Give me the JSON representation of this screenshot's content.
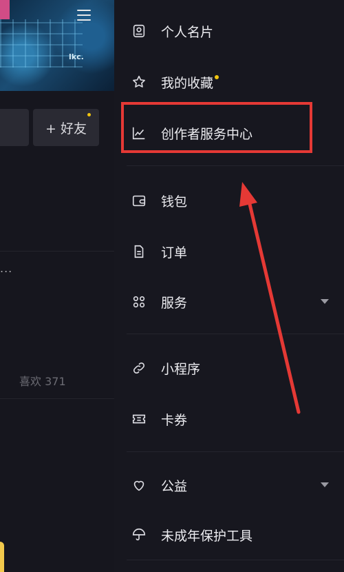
{
  "left_panel": {
    "cover_tag": "lkc.",
    "add_friend_label": "+ 好友",
    "more_label": "...",
    "likes_label": "喜欢 371"
  },
  "drawer": {
    "items": [
      {
        "label": "个人名片",
        "icon": "id-card-icon"
      },
      {
        "label": "我的收藏",
        "icon": "star-icon",
        "has_dot": true
      },
      {
        "label": "创作者服务中心",
        "icon": "trend-chart-icon",
        "highlighted": true
      },
      {
        "label": "钱包",
        "icon": "wallet-icon"
      },
      {
        "label": "订单",
        "icon": "document-icon"
      },
      {
        "label": "服务",
        "icon": "grid-services-icon",
        "expandable": true
      },
      {
        "label": "小程序",
        "icon": "link-icon"
      },
      {
        "label": "卡券",
        "icon": "coupon-icon"
      },
      {
        "label": "公益",
        "icon": "heart-icon",
        "expandable": true
      },
      {
        "label": "未成年保护工具",
        "icon": "umbrella-icon"
      }
    ]
  },
  "colors": {
    "highlight_box": "#e53935",
    "arrow": "#e53935",
    "notification_dot": "#f1c40f",
    "background": "#17171f"
  }
}
